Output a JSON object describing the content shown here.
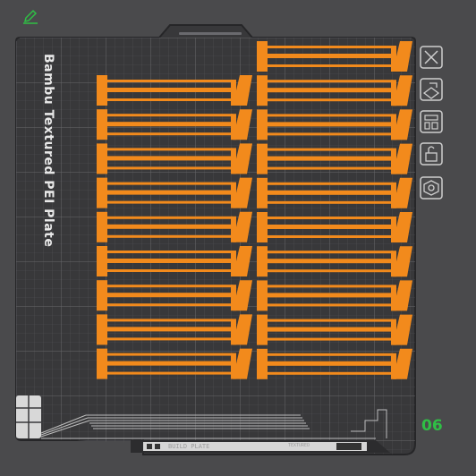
{
  "plate": {
    "name": "Bambu Textured PEI Plate",
    "number": "06"
  },
  "bottom_bar": {
    "text1": "BUILD PLATE",
    "text2": "TEXTURED"
  },
  "colors": {
    "background": "#4a4a4c",
    "plate_bg": "#3a3a3c",
    "grid": "#5d5d60",
    "part": "#f28a1c",
    "accent_green": "#2fbf45"
  },
  "toolbar": {
    "icons": [
      "close-icon",
      "auto-orient-icon",
      "arrange-icon",
      "lock-icon",
      "settings-icon"
    ]
  },
  "parts": {
    "left_column_count": 9,
    "right_column_count": 10
  }
}
